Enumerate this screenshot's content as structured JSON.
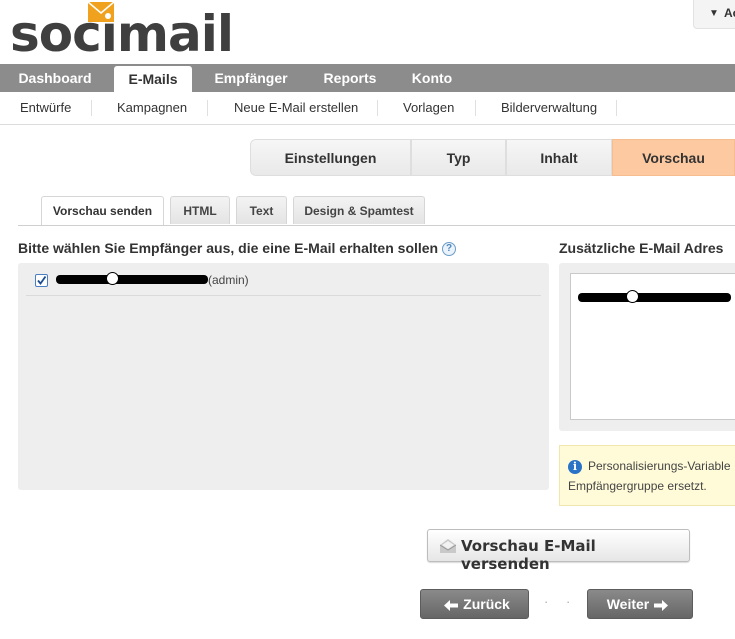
{
  "logo": {
    "text": "socimail"
  },
  "account": {
    "label": "Ac"
  },
  "main_nav": [
    {
      "label": "Dashboard"
    },
    {
      "label": "E-Mails"
    },
    {
      "label": "Empfänger"
    },
    {
      "label": "Reports"
    },
    {
      "label": "Konto"
    }
  ],
  "sub_nav": [
    {
      "label": "Entwürfe"
    },
    {
      "label": "Kampagnen"
    },
    {
      "label": "Neue E-Mail erstellen"
    },
    {
      "label": "Vorlagen"
    },
    {
      "label": "Bilderverwaltung"
    }
  ],
  "steps": [
    {
      "label": "Einstellungen"
    },
    {
      "label": "Typ"
    },
    {
      "label": "Inhalt"
    },
    {
      "label": "Vorschau"
    }
  ],
  "subtabs": [
    {
      "label": "Vorschau senden"
    },
    {
      "label": "HTML"
    },
    {
      "label": "Text"
    },
    {
      "label": "Design & Spamtest"
    }
  ],
  "left": {
    "heading": "Bitte wählen Sie Empfänger aus, die eine E-Mail erhalten sollen",
    "help": "?",
    "recipient_role": "(admin)"
  },
  "right": {
    "heading": "Zusätzliche E-Mail Adres",
    "info_line1": "Personalisierungs-Variable",
    "info_line2": "Empfängergruppe ersetzt.",
    "info_icon": "i"
  },
  "buttons": {
    "send_preview": "Vorschau E-Mail versenden",
    "back": "Zurück",
    "next": "Weiter",
    "dots": "· · ·"
  },
  "colors": {
    "accent": "#f5a623",
    "nav_bg": "#8c8c8c",
    "active_step": "#fdc9a0"
  },
  "icons": {
    "logo": "envelope-icon",
    "account": "caret-down-icon",
    "help": "help-icon",
    "info": "info-icon",
    "send": "envelope-open-icon",
    "back": "arrow-left-icon",
    "next": "arrow-right-icon"
  }
}
